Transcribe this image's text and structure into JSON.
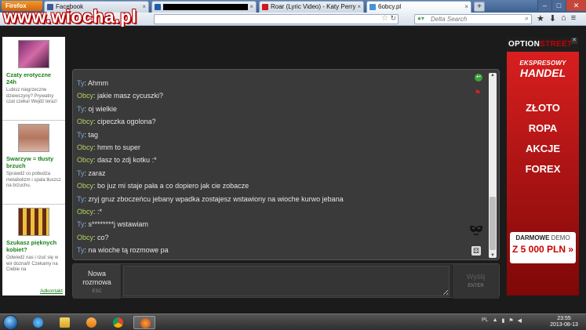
{
  "watermark": "www.wiocha.pl",
  "browser": {
    "app_button": "Firefox",
    "tabs": [
      {
        "label": "Facebook",
        "color": "#3b5998"
      },
      {
        "label": "",
        "color": "#1c5fa8"
      },
      {
        "label": "Roar (Lyric Video) - Katy Perry",
        "color": "#cc181e"
      },
      {
        "label": "6obcy.pl",
        "color": "#4a90d9"
      }
    ],
    "new_tab": "+",
    "search_placeholder": "Delta Search"
  },
  "left_ads": [
    {
      "title": "Czaty erotyczne 24h",
      "desc": "Lubisz niegrzeczne dziewczyny? Prywatny czat czeka! Wejdź teraz!"
    },
    {
      "title": "Swarzyw = tłusty brzuch",
      "desc": "Sprawdź co pobudza metabolizm i spala tłuszcz na brzuchu."
    },
    {
      "title": "Szukasz pięknych kobiet?",
      "desc": "Odwiedź nas i rzuć się w wir doznań! Czekamy na Ciebie na"
    }
  ],
  "adkontakt": "Adkontakt",
  "chat": {
    "messages": [
      {
        "who": "Ty",
        "text": "Ahmm"
      },
      {
        "who": "Obcy",
        "text": "jakie masz cycuszki?"
      },
      {
        "who": "Ty",
        "text": "oj wielkie"
      },
      {
        "who": "Obcy",
        "text": "cipeczka ogolona?"
      },
      {
        "who": "Ty",
        "text": "tag"
      },
      {
        "who": "Obcy",
        "text": "hmm to super"
      },
      {
        "who": "Obcy",
        "text": "dasz to zdj kotku :*"
      },
      {
        "who": "Ty",
        "text": "zaraz"
      },
      {
        "who": "Obcy",
        "text": "bo juz mi staje pała a co dopiero jak cie zobacze"
      },
      {
        "who": "Ty",
        "text": "zryj gruz zboczeńcu jebany wpadka zostajesz wstawiony na wioche kurwo jebana"
      },
      {
        "who": "Obcy",
        "text": ":*"
      },
      {
        "who": "Ty",
        "text": "s********j wstawiam"
      },
      {
        "who": "Obcy",
        "text": "co?"
      },
      {
        "who": "Ty",
        "text": "na wioche tą rozmowe pa"
      }
    ],
    "new_chat_label": "Nowa rozmowa",
    "new_chat_key": "ESC",
    "send_label": "Wyślij",
    "send_key": "ENTER",
    "input_value": ""
  },
  "right_ad": {
    "brand_a": "OPTION",
    "brand_b": "STREET",
    "line1": "EKSPRESOWY",
    "line2": "HANDEL",
    "items": [
      "ZŁOTO",
      "ROPA",
      "AKCJE",
      "FOREX"
    ],
    "demo_a": "DARMOWE",
    "demo_b": "DEMO",
    "demo_amount": "Z 5 000 PLN »"
  },
  "taskbar": {
    "lang": "PL",
    "time": "23:55",
    "date": "2013-08-13"
  }
}
